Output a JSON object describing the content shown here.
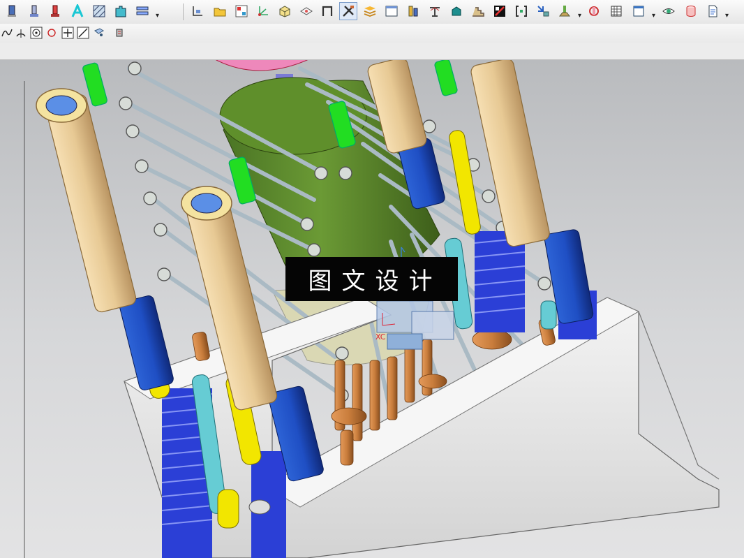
{
  "toolbar": {
    "icons": [
      "ejector-pin-icon",
      "sleeve-icon",
      "return-pin-icon",
      "text-a-icon",
      "hatch-pattern-icon",
      "slot-block-icon",
      "stack-plates-icon",
      "wcs-display-icon",
      "folder-open-icon",
      "grid-matrix-icon",
      "axis-xyz-icon",
      "box-solid-icon",
      "plane-icon",
      "n-shape-icon",
      "trim-tools-icon",
      "layers-icon",
      "frame-icon",
      "gauge-icon",
      "measure-icon",
      "bucket-icon",
      "stairs-icon",
      "section-view-icon",
      "bracket-icon",
      "align-icon",
      "pin-support-icon",
      "rotate-part-icon",
      "table-grid-icon",
      "window-icon",
      "eye-icon",
      "cylinder-icon",
      "document-icon"
    ],
    "active_icon": "trim-tools-icon"
  },
  "snap_toolbar": {
    "icons": [
      "curve-snap-icon",
      "arc-snap-icon",
      "center-snap-icon",
      "quadrant-snap-icon",
      "point-snap-icon",
      "line-snap-icon",
      "face-snap-icon",
      "filter-icon"
    ]
  },
  "viewport": {
    "watermark": "图文设计",
    "axis_label": "XC",
    "colors": {
      "mold_plate": "#e8e8e8",
      "guide_pillar": "#e7c994",
      "core_cylinder": "#5d8a2e",
      "spring": "#2b3fd6",
      "stand": "#1f4fc4",
      "yellow_pin": "#f2e600",
      "screw_head": "#22dd22",
      "rod": "#aabac4",
      "cyan_coil": "#66ccd4",
      "copper_pin": "#c97d3c",
      "ring": "#ee88bb"
    }
  }
}
